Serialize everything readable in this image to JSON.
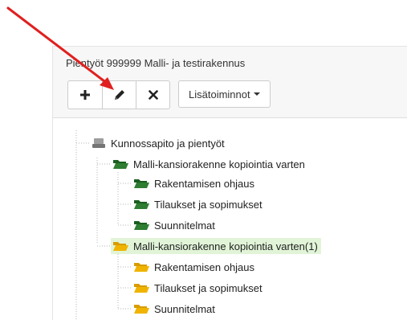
{
  "panel": {
    "title": "Pientyöt 999999 Malli- ja testirakennus"
  },
  "toolbar": {
    "add_icon": "plus-icon",
    "edit_icon": "pencil-icon",
    "delete_icon": "close-icon",
    "more_label": "Lisätoiminnot"
  },
  "tree": {
    "root": {
      "label": "Kunnossapito ja pientyöt",
      "icon": "drive-icon"
    },
    "groups": [
      {
        "label": "Malli-kansiorakenne kopiointia varten",
        "icon": "folder-open-icon",
        "color": "#2e7d32",
        "selected": false,
        "children": [
          {
            "label": "Rakentamisen ohjaus"
          },
          {
            "label": "Tilaukset ja sopimukset"
          },
          {
            "label": "Suunnitelmat"
          }
        ]
      },
      {
        "label": "Malli-kansiorakenne kopiointia varten(1)",
        "icon": "folder-open-icon",
        "color": "#f0b400",
        "selected": true,
        "children": [
          {
            "label": "Rakentamisen ohjaus"
          },
          {
            "label": "Tilaukset ja sopimukset"
          },
          {
            "label": "Suunnitelmat"
          }
        ]
      }
    ]
  },
  "colors": {
    "green_folder": "#2e7d32",
    "yellow_folder": "#f0b400",
    "selected_bg": "#e1f4d8",
    "annotation_arrow": "#e02020"
  }
}
